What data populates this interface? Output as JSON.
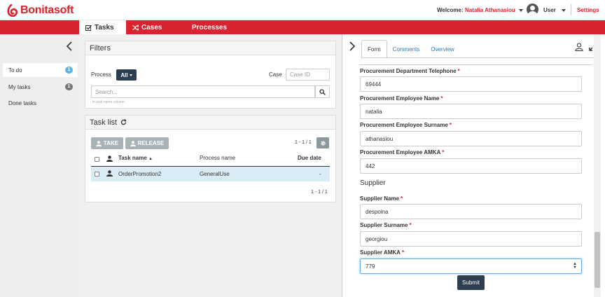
{
  "brand": {
    "name": "Bonitasoft",
    "color": "#d9232e"
  },
  "header": {
    "welcome_label": "Welcome:",
    "user_full_name": "Natalia Athanasiou",
    "user_label": "User",
    "settings_label": "Settings"
  },
  "nav": {
    "tabs": [
      {
        "label": "Tasks",
        "icon": "check-square-icon",
        "active": true
      },
      {
        "label": "Cases",
        "icon": "shuffle-icon",
        "active": false
      },
      {
        "label": "Processes",
        "icon": "",
        "active": false
      }
    ]
  },
  "sidebar": {
    "items": [
      {
        "label": "To do",
        "count": "1",
        "active": true
      },
      {
        "label": "My tasks",
        "count": "1",
        "active": false
      },
      {
        "label": "Done tasks",
        "count": "",
        "active": false
      }
    ]
  },
  "filters": {
    "title": "Filters",
    "process_label": "Process",
    "process_value": "All",
    "case_label": "Case",
    "case_placeholder": "Case ID",
    "search_placeholder": "Search...",
    "search_hint": "in task name column"
  },
  "task_list": {
    "title": "Task list",
    "take_label": "TAKE",
    "release_label": "RELEASE",
    "pager_top": "1 - 1 / 1",
    "pager_bottom": "1 - 1 / 1",
    "columns": [
      "Task name",
      "Process name",
      "Due date"
    ],
    "rows": [
      {
        "task_name": "OrderPromotion2",
        "process_name": "GeneralUse",
        "due_date": "-"
      }
    ]
  },
  "detail": {
    "tabs": [
      "Form",
      "Comments",
      "Overview"
    ],
    "active_tab": "Form"
  },
  "form": {
    "fields": [
      {
        "label": "Procurement Department Telephone",
        "value": "69444"
      },
      {
        "label": "Procurement Employee Name",
        "value": "natalia"
      },
      {
        "label": "Procurement Employee Surname",
        "value": "athanasiou"
      },
      {
        "label": "Procurement Employee AMKA",
        "value": "442"
      }
    ],
    "supplier_section": "Supplier",
    "supplier_fields": [
      {
        "label": "Supplier Name",
        "value": "despoina"
      },
      {
        "label": "Supplier Surname",
        "value": "georgiou"
      },
      {
        "label": "Supplier AMKA",
        "value": "779"
      }
    ],
    "required_mark": "*",
    "submit_label": "Submit"
  }
}
